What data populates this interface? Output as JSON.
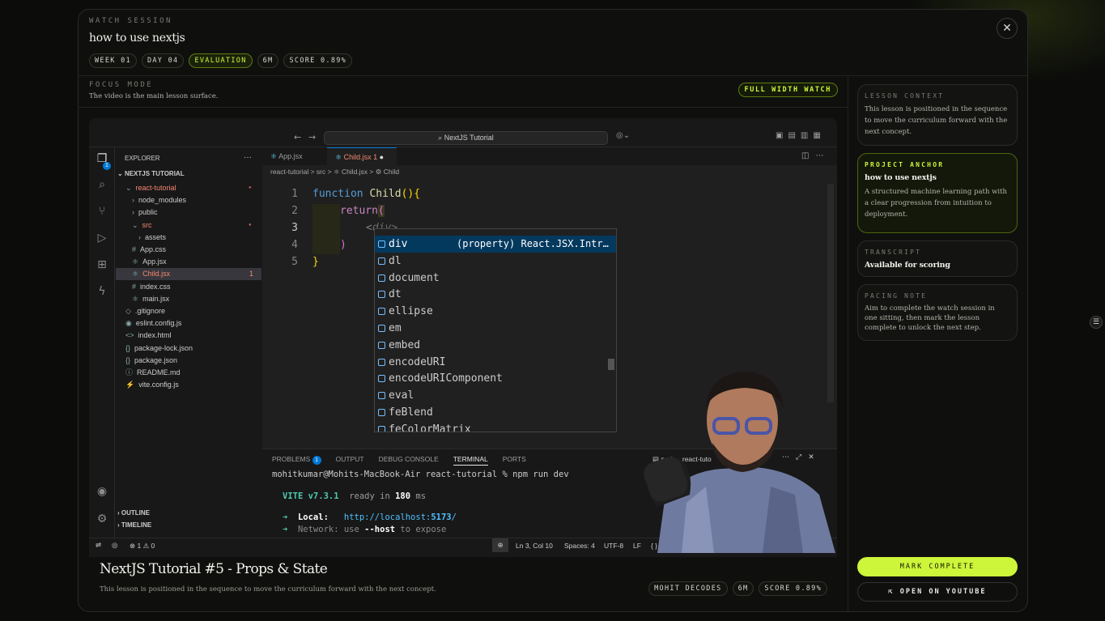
{
  "header": {
    "kicker": "WATCH SESSION",
    "title": "how to use nextjs",
    "chips": [
      "WEEK 01",
      "DAY 04",
      "EVALUATION",
      "6M",
      "SCORE 0.89%"
    ],
    "close_glyph": "✕"
  },
  "focus": {
    "kicker": "FOCUS MODE",
    "subtitle": "The video is the main lesson surface.",
    "full_width": "FULL WIDTH WATCH"
  },
  "vscode": {
    "search": "NextJS Tutorial",
    "explorer_title": "EXPLORER",
    "project": "NEXTJS TUTORIAL",
    "tree": [
      {
        "label": "react-tutorial",
        "icon": "⌄",
        "color": "#f48771"
      },
      {
        "label": "node_modules",
        "icon": "›",
        "color": "#cccccc"
      },
      {
        "label": "public",
        "icon": "›",
        "color": "#cccccc"
      },
      {
        "label": "src",
        "icon": "⌄",
        "color": "#f48771"
      },
      {
        "label": "assets",
        "icon": "›",
        "color": "#cccccc"
      },
      {
        "label": "App.css",
        "icon": "#",
        "color": "#cccccc"
      },
      {
        "label": "App.jsx",
        "icon": "⚛",
        "color": "#cccccc"
      },
      {
        "label": "Child.jsx",
        "icon": "⚛",
        "color": "#f48771"
      },
      {
        "label": "index.css",
        "icon": "#",
        "color": "#cccccc"
      },
      {
        "label": "main.jsx",
        "icon": "⚛",
        "color": "#cccccc"
      },
      {
        "label": ".gitignore",
        "icon": "◇",
        "color": "#cccccc"
      },
      {
        "label": "eslint.config.js",
        "icon": "◉",
        "color": "#cccccc"
      },
      {
        "label": "index.html",
        "icon": "<>",
        "color": "#cccccc"
      },
      {
        "label": "package-lock.json",
        "icon": "{}",
        "color": "#cccccc"
      },
      {
        "label": "package.json",
        "icon": "{}",
        "color": "#cccccc"
      },
      {
        "label": "README.md",
        "icon": "ⓘ",
        "color": "#cccccc"
      },
      {
        "label": "vite.config.js",
        "icon": "⚡",
        "color": "#cccccc"
      }
    ],
    "child_badge": "1",
    "outline": "OUTLINE",
    "timeline": "TIMELINE",
    "tabs": [
      {
        "label": "App.jsx"
      },
      {
        "label": "Child.jsx 1"
      }
    ],
    "breadcrumb": "react-tutorial > src > ⚛ Child.jsx > ⚙ Child",
    "lines": [
      "1",
      "2",
      "3",
      "4",
      "5"
    ],
    "code": {
      "l1a": "function ",
      "l1b": "Child",
      "l1c": "(){",
      "l2": "return",
      "l2b": "(",
      "l3a": "<",
      "l3b": "div>",
      "l4": ")",
      "l5": "}"
    },
    "suggestions": [
      "div",
      "dl",
      "document",
      "dt",
      "ellipse",
      "em",
      "embed",
      "encodeURI",
      "encodeURIComponent",
      "eval",
      "feBlend",
      "feColorMatrix"
    ],
    "suggest_detail": "(property) React.JSX.Intr…",
    "panel_tabs": [
      "PROBLEMS",
      "OUTPUT",
      "DEBUG CONSOLE",
      "TERMINAL",
      "PORTS"
    ],
    "problems_count": "1",
    "terminal_name": "node - react-tuto",
    "term": {
      "prompt": "mohitkumar@Mohits-MacBook-Air react-tutorial % npm run dev",
      "vite": "VITE v7.3.1",
      "ready": "ready in",
      "ms": "180",
      "msu": "ms",
      "local_label": "Local:",
      "local_url": "http://localhost:",
      "local_port": "5173",
      "local_end": "/",
      "network": "Network: use",
      "host": "--host",
      "expose": "to expose"
    },
    "status": {
      "errors": "⊗ 1 ⚠ 0",
      "pos": "Ln 3, Col 10",
      "spaces": "Spaces: 4",
      "enc": "UTF-8",
      "eol": "LF",
      "lang": "{ } Jav"
    }
  },
  "lower": {
    "title": "NextJS Tutorial #5 - Props & State",
    "subtitle": "This lesson is positioned in the sequence to move the curriculum forward with the next concept.",
    "chips": [
      "MOHIT DECODES",
      "6M",
      "SCORE 0.89%"
    ]
  },
  "sidebar": {
    "lesson_context": {
      "kicker": "LESSON CONTEXT",
      "body": "This lesson is positioned in the sequence to move the curriculum forward with the next concept."
    },
    "project_anchor": {
      "kicker": "PROJECT ANCHOR",
      "title": "how to use nextjs",
      "body": "A structured machine learning path with a clear progression from intuition to deployment."
    },
    "transcript": {
      "kicker": "TRANSCRIPT",
      "title": "Available for scoring"
    },
    "pacing": {
      "kicker": "PACING NOTE",
      "body": "Aim to complete the watch session in one sitting, then mark the lesson complete to unlock the next step."
    },
    "mark_complete": "MARK COMPLETE",
    "youtube": "OPEN ON YOUTUBE"
  },
  "colors": {
    "accent": "#cdf53a",
    "bg": "#0f100e",
    "vscode_bg": "#1f1f1f",
    "selection": "#04395e"
  }
}
